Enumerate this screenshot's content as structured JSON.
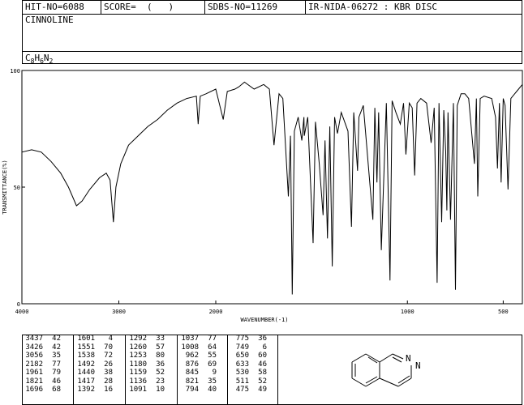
{
  "header": {
    "hit_no": "HIT-NO=6088",
    "score": "SCORE=  (   )",
    "sdbs_no": "SDBS-NO=11269",
    "ir_nida": "IR-NIDA-06272 : KBR DISC",
    "compound": "CINNOLINE",
    "formula_parts": [
      "C",
      "8",
      "H",
      "6",
      "N",
      "2"
    ]
  },
  "chart_data": {
    "type": "line",
    "xlabel": "WAVENUMBER(-1)",
    "ylabel": "TRANSMITTANCE(%)",
    "x_ticks": [
      "4000",
      "3000",
      "2000",
      "1000",
      "500"
    ],
    "y_ticks": [
      "100",
      "50",
      "0"
    ],
    "xlim": [
      4000,
      400
    ],
    "ylim": [
      0,
      100
    ],
    "series": [
      {
        "points": [
          [
            4000,
            65
          ],
          [
            3900,
            66
          ],
          [
            3800,
            65
          ],
          [
            3700,
            61
          ],
          [
            3600,
            56
          ],
          [
            3520,
            50
          ],
          [
            3437,
            42
          ],
          [
            3380,
            44
          ],
          [
            3300,
            49
          ],
          [
            3200,
            54
          ],
          [
            3130,
            56
          ],
          [
            3090,
            53
          ],
          [
            3056,
            35
          ],
          [
            3030,
            50
          ],
          [
            2980,
            60
          ],
          [
            2900,
            68
          ],
          [
            2800,
            72
          ],
          [
            2700,
            76
          ],
          [
            2600,
            79
          ],
          [
            2500,
            83
          ],
          [
            2400,
            86
          ],
          [
            2300,
            88
          ],
          [
            2200,
            89
          ],
          [
            2182,
            77
          ],
          [
            2160,
            89
          ],
          [
            2100,
            90
          ],
          [
            2000,
            92
          ],
          [
            1961,
            79
          ],
          [
            1940,
            91
          ],
          [
            1900,
            92
          ],
          [
            1880,
            93
          ],
          [
            1850,
            95
          ],
          [
            1800,
            92
          ],
          [
            1750,
            94
          ],
          [
            1720,
            92
          ],
          [
            1696,
            68
          ],
          [
            1670,
            90
          ],
          [
            1650,
            88
          ],
          [
            1621,
            46
          ],
          [
            1610,
            72
          ],
          [
            1601,
            4
          ],
          [
            1590,
            74
          ],
          [
            1570,
            80
          ],
          [
            1551,
            70
          ],
          [
            1540,
            80
          ],
          [
            1538,
            72
          ],
          [
            1520,
            80
          ],
          [
            1492,
            26
          ],
          [
            1480,
            78
          ],
          [
            1460,
            60
          ],
          [
            1440,
            38
          ],
          [
            1430,
            70
          ],
          [
            1417,
            28
          ],
          [
            1405,
            76
          ],
          [
            1392,
            16
          ],
          [
            1380,
            80
          ],
          [
            1365,
            73
          ],
          [
            1345,
            82
          ],
          [
            1310,
            74
          ],
          [
            1292,
            33
          ],
          [
            1280,
            82
          ],
          [
            1260,
            57
          ],
          [
            1253,
            80
          ],
          [
            1230,
            85
          ],
          [
            1180,
            36
          ],
          [
            1170,
            84
          ],
          [
            1159,
            52
          ],
          [
            1150,
            82
          ],
          [
            1136,
            23
          ],
          [
            1110,
            86
          ],
          [
            1091,
            10
          ],
          [
            1080,
            87
          ],
          [
            1060,
            82
          ],
          [
            1037,
            77
          ],
          [
            1020,
            86
          ],
          [
            1008,
            64
          ],
          [
            990,
            86
          ],
          [
            975,
            84
          ],
          [
            962,
            55
          ],
          [
            950,
            86
          ],
          [
            930,
            88
          ],
          [
            900,
            86
          ],
          [
            876,
            69
          ],
          [
            860,
            84
          ],
          [
            845,
            9
          ],
          [
            835,
            86
          ],
          [
            821,
            35
          ],
          [
            810,
            83
          ],
          [
            800,
            65
          ],
          [
            794,
            40
          ],
          [
            788,
            82
          ],
          [
            775,
            36
          ],
          [
            760,
            86
          ],
          [
            749,
            6
          ],
          [
            740,
            85
          ],
          [
            720,
            90
          ],
          [
            700,
            90
          ],
          [
            680,
            88
          ],
          [
            650,
            60
          ],
          [
            640,
            88
          ],
          [
            633,
            46
          ],
          [
            620,
            88
          ],
          [
            600,
            89
          ],
          [
            560,
            88
          ],
          [
            540,
            80
          ],
          [
            530,
            58
          ],
          [
            520,
            86
          ],
          [
            511,
            52
          ],
          [
            500,
            88
          ],
          [
            490,
            85
          ],
          [
            475,
            49
          ],
          [
            460,
            88
          ],
          [
            440,
            90
          ],
          [
            420,
            92
          ],
          [
            400,
            94
          ]
        ]
      }
    ],
    "peaks": [
      {
        "wn": 3437,
        "t": 42
      },
      {
        "wn": 3426,
        "t": 42
      },
      {
        "wn": 3056,
        "t": 35
      },
      {
        "wn": 2182,
        "t": 77
      },
      {
        "wn": 1961,
        "t": 79
      },
      {
        "wn": 1821,
        "t": 46
      },
      {
        "wn": 1696,
        "t": 68
      },
      {
        "wn": 1601,
        "t": 4
      },
      {
        "wn": 1551,
        "t": 70
      },
      {
        "wn": 1538,
        "t": 72
      },
      {
        "wn": 1492,
        "t": 26
      },
      {
        "wn": 1440,
        "t": 38
      },
      {
        "wn": 1417,
        "t": 28
      },
      {
        "wn": 1392,
        "t": 16
      },
      {
        "wn": 1292,
        "t": 33
      },
      {
        "wn": 1260,
        "t": 57
      },
      {
        "wn": 1253,
        "t": 80
      },
      {
        "wn": 1180,
        "t": 36
      },
      {
        "wn": 1159,
        "t": 52
      },
      {
        "wn": 1136,
        "t": 23
      },
      {
        "wn": 1091,
        "t": 10
      },
      {
        "wn": 1037,
        "t": 77
      },
      {
        "wn": 1008,
        "t": 64
      },
      {
        "wn": 962,
        "t": 55
      },
      {
        "wn": 876,
        "t": 69
      },
      {
        "wn": 845,
        "t": 9
      },
      {
        "wn": 821,
        "t": 35
      },
      {
        "wn": 794,
        "t": 40
      },
      {
        "wn": 775,
        "t": 36
      },
      {
        "wn": 749,
        "t": 6
      },
      {
        "wn": 650,
        "t": 60
      },
      {
        "wn": 633,
        "t": 46
      },
      {
        "wn": 530,
        "t": 58
      },
      {
        "wn": 511,
        "t": 52
      },
      {
        "wn": 475,
        "t": 49
      }
    ],
    "grid": false
  },
  "structure": {
    "name": "cinnoline-structure",
    "atom_labels": [
      "N",
      "N"
    ]
  }
}
